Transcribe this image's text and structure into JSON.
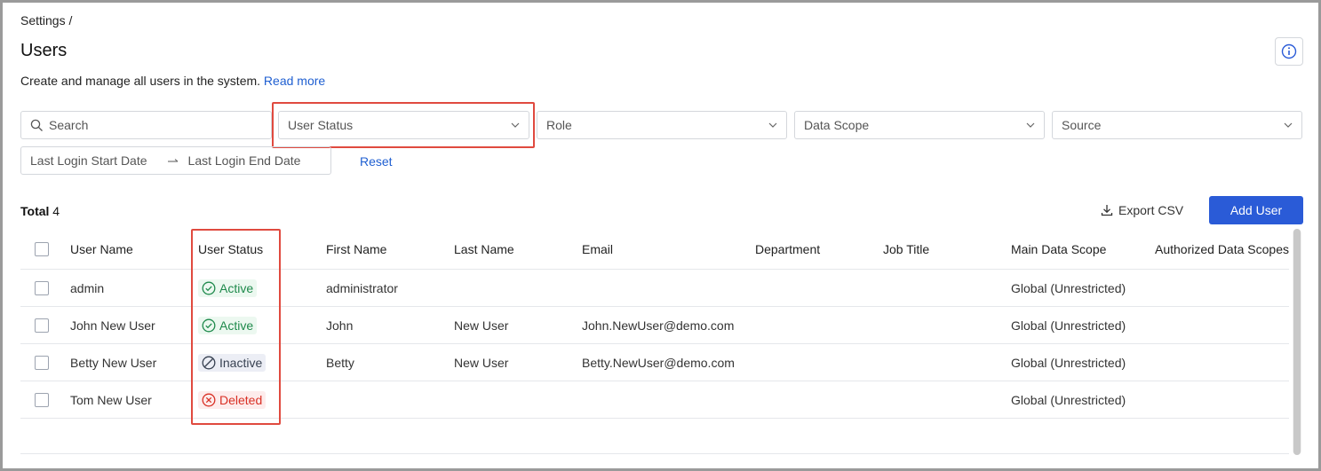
{
  "breadcrumb": "Settings /",
  "page": {
    "title": "Users",
    "description": "Create and manage all users in the system.",
    "read_more": "Read more"
  },
  "filters": {
    "search_placeholder": "Search",
    "user_status": "User Status",
    "role": "Role",
    "data_scope": "Data Scope",
    "source": "Source",
    "last_login_start": "Last Login Start Date",
    "last_login_end": "Last Login End Date",
    "reset": "Reset"
  },
  "toolbar": {
    "total_label": "Total",
    "total_count": "4",
    "export_label": "Export CSV",
    "add_label": "Add User"
  },
  "table": {
    "columns": [
      "User Name",
      "User Status",
      "First Name",
      "Last Name",
      "Email",
      "Department",
      "Job Title",
      "Main Data Scope",
      "Authorized Data Scopes"
    ],
    "rows": [
      {
        "user_name": "admin",
        "status": "Active",
        "first_name": "administrator",
        "last_name": "",
        "email": "",
        "department": "",
        "job_title": "",
        "main_scope": "Global (Unrestricted)",
        "auth_scopes": ""
      },
      {
        "user_name": "John New User",
        "status": "Active",
        "first_name": "John",
        "last_name": "New User",
        "email": "John.NewUser@demo.com",
        "department": "",
        "job_title": "",
        "main_scope": "Global (Unrestricted)",
        "auth_scopes": ""
      },
      {
        "user_name": "Betty New User",
        "status": "Inactive",
        "first_name": "Betty",
        "last_name": "New User",
        "email": "Betty.NewUser@demo.com",
        "department": "",
        "job_title": "",
        "main_scope": "Global (Unrestricted)",
        "auth_scopes": ""
      },
      {
        "user_name": "Tom New User",
        "status": "Deleted",
        "first_name": "",
        "last_name": "",
        "email": "",
        "department": "",
        "job_title": "",
        "main_scope": "Global (Unrestricted)",
        "auth_scopes": ""
      }
    ]
  },
  "colors": {
    "primary": "#2a5bd7",
    "link": "#1f5fd1",
    "active": "#1f8a4c",
    "deleted": "#d93025",
    "highlight": "#e04a3f"
  }
}
